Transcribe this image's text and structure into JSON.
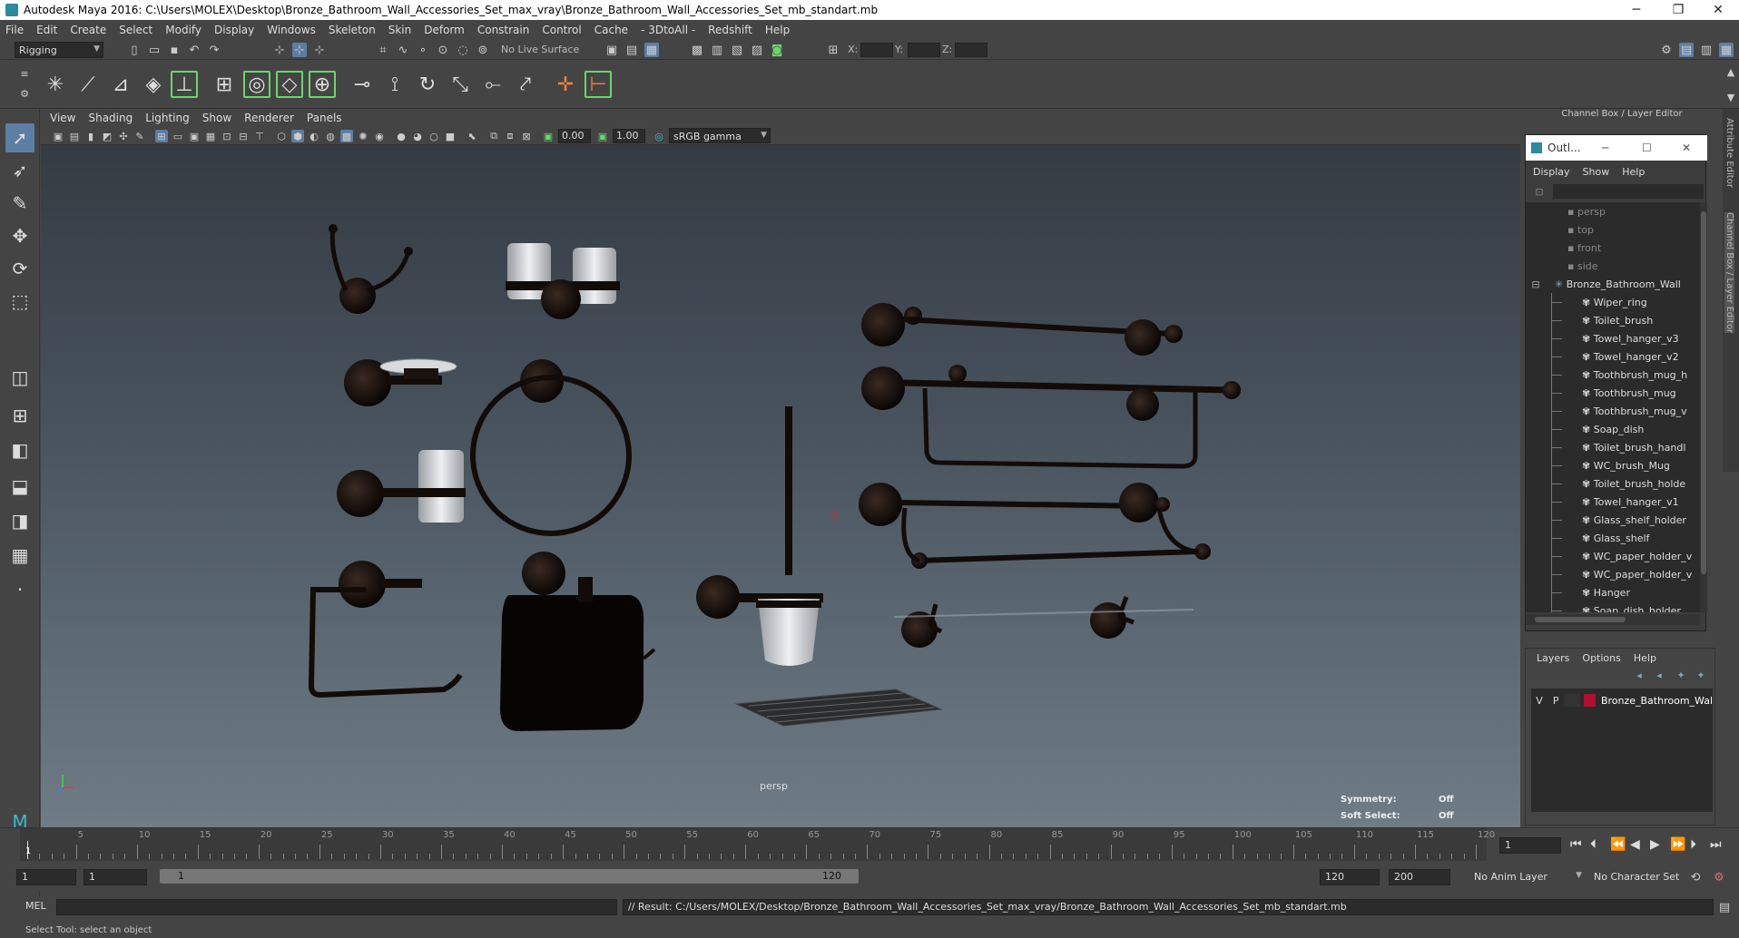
{
  "window": {
    "title": "Autodesk Maya 2016: C:\\Users\\MOLEX\\Desktop\\Bronze_Bathroom_Wall_Accessories_Set_max_vray\\Bronze_Bathroom_Wall_Accessories_Set_mb_standart.mb",
    "minimize": "─",
    "maximize": "❐",
    "close": "✕"
  },
  "menubar": [
    "File",
    "Edit",
    "Create",
    "Select",
    "Modify",
    "Display",
    "Windows",
    "Skeleton",
    "Skin",
    "Deform",
    "Constrain",
    "Control",
    "Cache",
    "- 3DtoAll -",
    "Redshift",
    "Help"
  ],
  "statusline": {
    "mode": "Rigging",
    "live_surface": "No Live Surface",
    "x_label": "X:",
    "y_label": "Y:",
    "z_label": "Z:"
  },
  "viewport": {
    "menu": [
      "View",
      "Shading",
      "Lighting",
      "Show",
      "Renderer",
      "Panels"
    ],
    "exposure": "0.00",
    "gamma": "1.00",
    "color_space": "sRGB gamma",
    "camera": "persp",
    "symmetry_label": "Symmetry:",
    "symmetry_value": "Off",
    "soft_select_label": "Soft Select:",
    "soft_select_value": "Off"
  },
  "channel_box": {
    "title": "Channel Box / Layer Editor"
  },
  "outliner": {
    "title": "Outl...",
    "menu": [
      "Display",
      "Show",
      "Help"
    ],
    "cameras": [
      "persp",
      "top",
      "front",
      "side"
    ],
    "group": "Bronze_Bathroom_Wall",
    "items": [
      "Wiper_ring",
      "Toilet_brush",
      "Towel_hanger_v3",
      "Towel_hanger_v2",
      "Toothbrush_mug_h",
      "Toothbrush_mug",
      "Toothbrush_mug_v",
      "Soap_dish",
      "Toilet_brush_handl",
      "WC_brush_Mug",
      "Toilet_brush_holde",
      "Towel_hanger_v1",
      "Glass_shelf_holder",
      "Glass_shelf",
      "WC_paper_holder_v",
      "WC_paper_holder_v",
      "Hanger",
      "Soap_dish_holder"
    ]
  },
  "layers": {
    "menu": [
      "Layers",
      "Options",
      "Help"
    ],
    "layer": {
      "v": "V",
      "p": "P",
      "name": "Bronze_Bathroom_Wal",
      "color": "#b01030"
    }
  },
  "side_tabs": [
    "Attribute Editor",
    "Channel Box / Layer Editor"
  ],
  "timeline": {
    "ticks": [
      "5",
      "10",
      "15",
      "20",
      "25",
      "30",
      "35",
      "40",
      "45",
      "50",
      "55",
      "60",
      "65",
      "70",
      "75",
      "80",
      "85",
      "90",
      "95",
      "100",
      "105",
      "110",
      "115",
      "120"
    ],
    "current_frame": "1",
    "current_frame_marker": "1"
  },
  "range": {
    "start": "1",
    "anim_start": "1",
    "slider_start": "1",
    "slider_end": "120",
    "anim_end": "120",
    "end": "200",
    "anim_layer": "No Anim Layer",
    "character_set": "No Character Set"
  },
  "command": {
    "label": "MEL",
    "result": "// Result: C:/Users/MOLEX/Desktop/Bronze_Bathroom_Wall_Accessories_Set_max_vray/Bronze_Bathroom_Wall_Accessories_Set_mb_standart.mb"
  },
  "help_line": "Select Tool: select an object"
}
